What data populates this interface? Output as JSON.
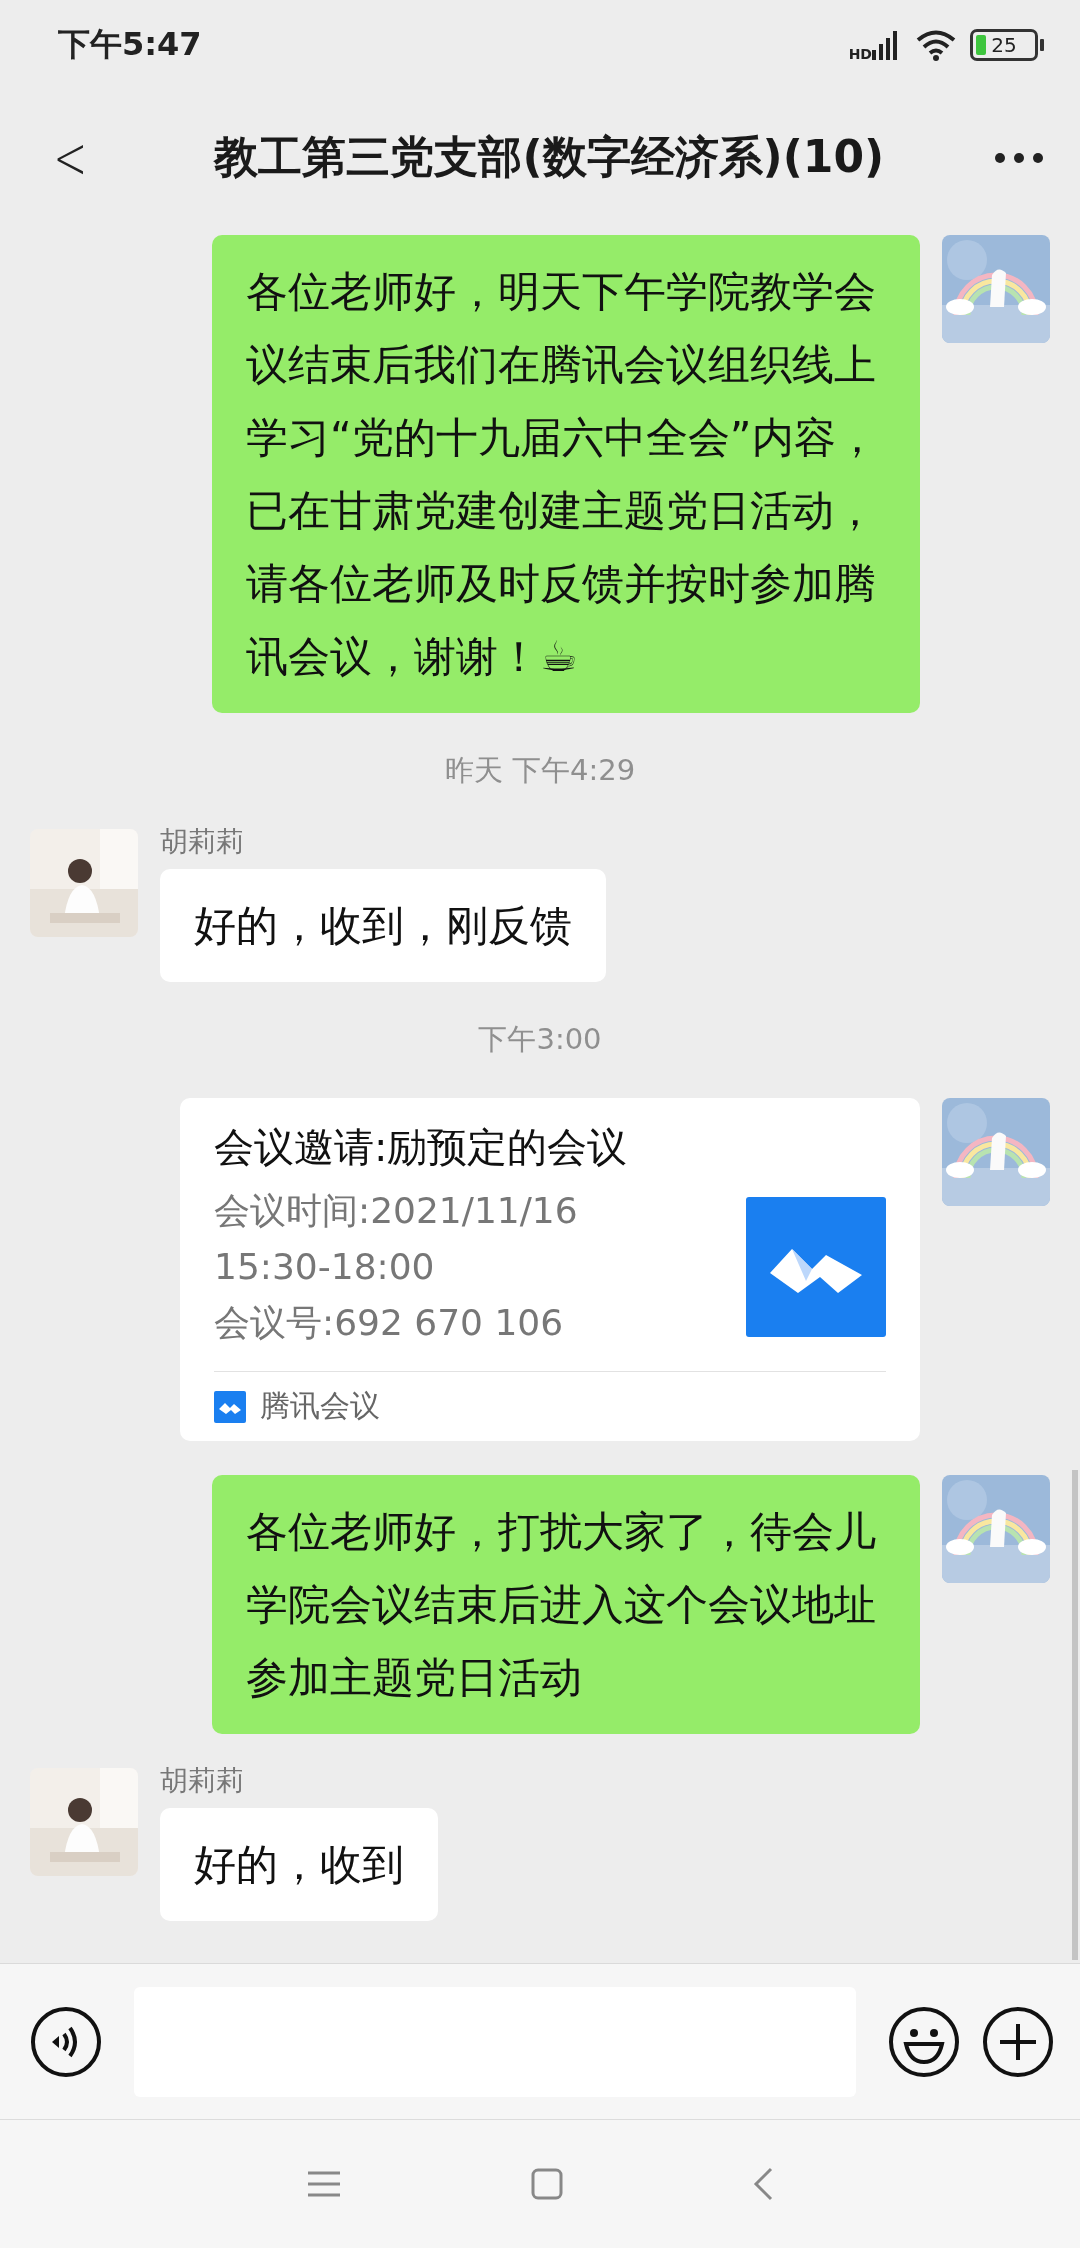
{
  "status_bar": {
    "time": "下午5:47",
    "network": "HD",
    "battery": "25"
  },
  "header": {
    "back": "<",
    "title": "教工第三党支部(数字经济系)(10)"
  },
  "messages": [
    {
      "kind": "text",
      "from_me": true,
      "text": "各位老师好，明天下午学院教学会议结束后我们在腾讯会议组织线上学习“党的十九届六中全会”内容，已在甘肃党建创建主题党日活动，请各位老师及时反馈并按时参加腾讯会议，谢谢！☕"
    },
    {
      "kind": "time",
      "text": "昨天 下午4:29"
    },
    {
      "kind": "text",
      "from_me": false,
      "sender": "胡莉莉",
      "text": "好的，收到，刚反馈"
    },
    {
      "kind": "time",
      "text": "下午3:00"
    },
    {
      "kind": "card",
      "from_me": true,
      "title": "会议邀请:励预定的会议",
      "lines": [
        "会议时间:2021/11/16",
        "15:30-18:00",
        "会议号:692 670 106"
      ],
      "source": "腾讯会议"
    },
    {
      "kind": "text",
      "from_me": true,
      "text": "各位老师好，打扰大家了，待会儿学院会议结束后进入这个会议地址参加主题党日活动"
    },
    {
      "kind": "text",
      "from_me": false,
      "sender": "胡莉莉",
      "text": "好的，收到"
    }
  ]
}
